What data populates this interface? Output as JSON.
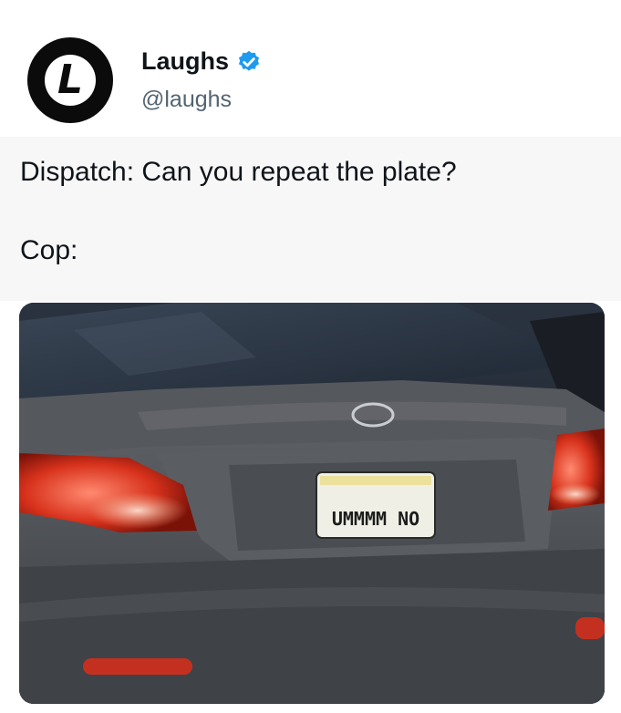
{
  "post": {
    "display_name": "Laughs",
    "handle": "@laughs",
    "avatar_letter": "L",
    "verified": true,
    "lines": [
      "Dispatch: Can you repeat the plate?",
      "Cop:"
    ]
  },
  "media": {
    "plate_text": "UMMMM NO",
    "accent": "#1d9bf0"
  }
}
